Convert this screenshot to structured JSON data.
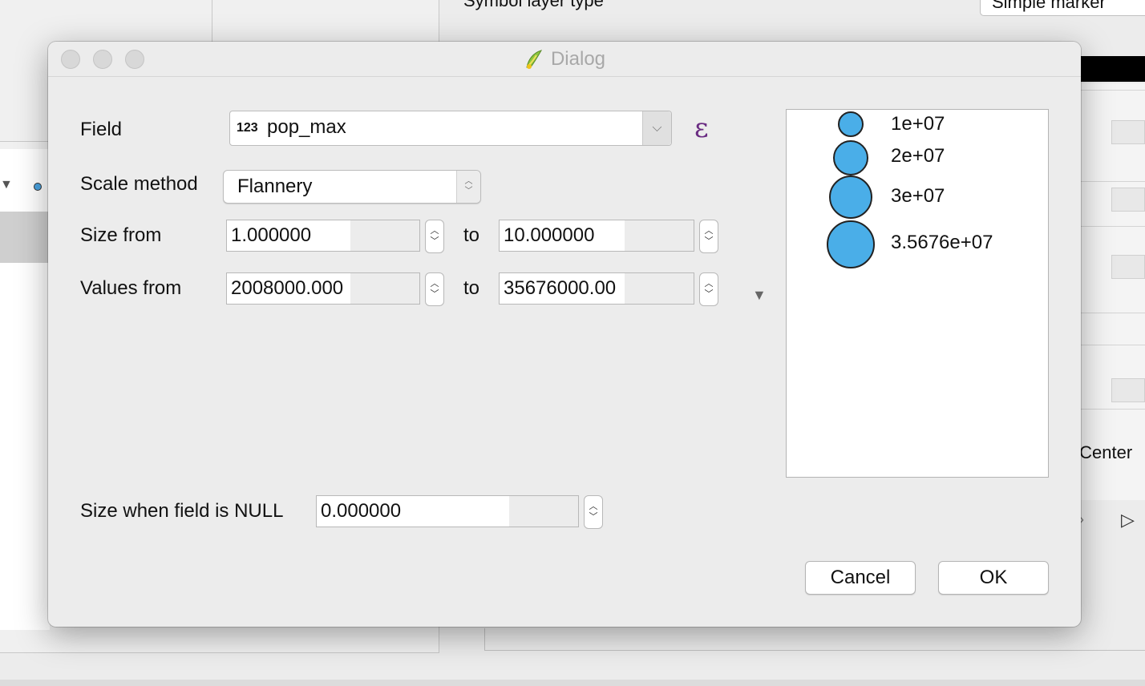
{
  "background": {
    "symbol_layer_label": "Symbol layer type",
    "symbol_layer_value": "Simple marker",
    "right_text": "/Center"
  },
  "dialog": {
    "title": "Dialog",
    "field": {
      "label": "Field",
      "type_badge": "123",
      "value": "pop_max",
      "expression_icon": "epsilon-icon"
    },
    "scale_method": {
      "label": "Scale method",
      "value": "Flannery"
    },
    "size_from": {
      "label": "Size from",
      "from": "1.000000",
      "to_label": "to",
      "to": "10.000000"
    },
    "values_from": {
      "label": "Values from",
      "from": "2008000.000",
      "to_label": "to",
      "to": "35676000.00"
    },
    "null_size": {
      "label": "Size when field is NULL",
      "value": "0.000000"
    },
    "legend": {
      "items": [
        {
          "label": "1e+07"
        },
        {
          "label": "2e+07"
        },
        {
          "label": "3e+07"
        },
        {
          "label": "3.5676e+07"
        }
      ],
      "circle_color": "#4aaee8"
    },
    "buttons": {
      "cancel": "Cancel",
      "ok": "OK"
    }
  }
}
